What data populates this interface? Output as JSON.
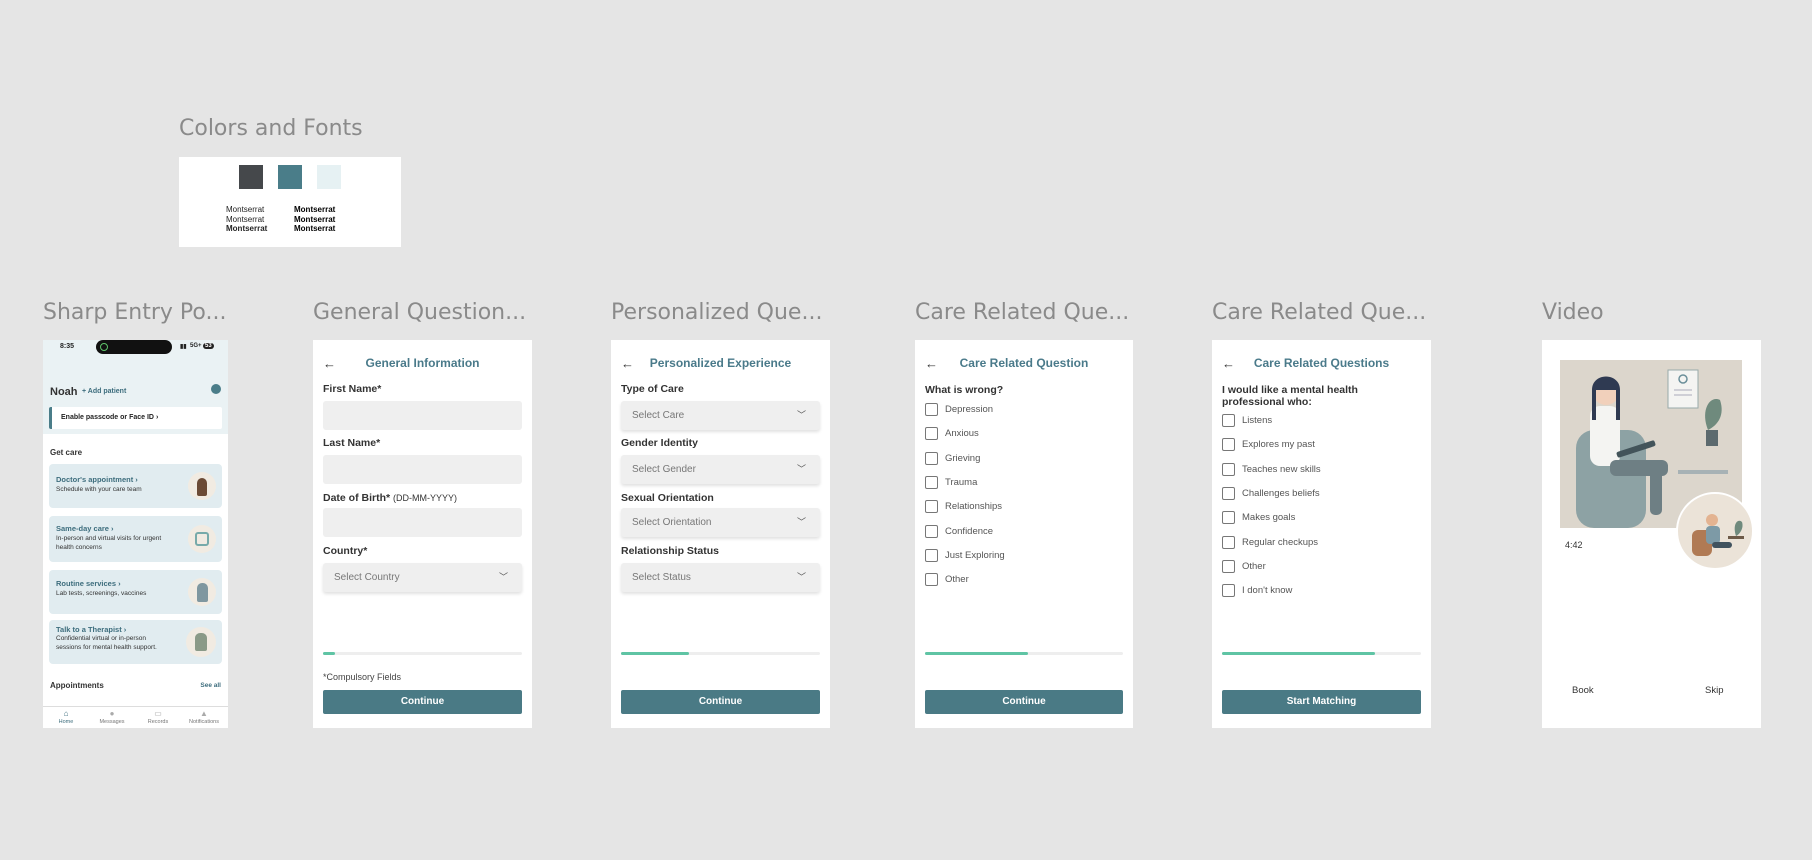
{
  "colors_section": {
    "title": "Colors and Fonts",
    "swatches": [
      "#45484b",
      "#4a7d89",
      "#e6f1f3"
    ],
    "font_samples_regular": [
      "Montserrat",
      "Montserrat",
      "Montserrat"
    ],
    "font_samples_bold": [
      "Montserrat",
      "Montserrat",
      "Montserrat"
    ]
  },
  "frames": {
    "sharp_title": "Sharp Entry Po...",
    "general_title": "General Question...",
    "personalized_title": "Personalized Que...",
    "care1_title": "Care Related Que...",
    "care2_title": "Care Related Que...",
    "video_title": "Video"
  },
  "sharp": {
    "time": "8:35",
    "status_right": "5G+",
    "battery": "53",
    "user_name": "Noah",
    "add_patient": "+ Add patient",
    "banner": "Enable passcode or Face ID",
    "get_care": "Get care",
    "cards": [
      {
        "title": "Doctor's appointment",
        "sub": "Schedule with your care team"
      },
      {
        "title": "Same-day care",
        "sub": "In-person and virtual visits for urgent health concerns"
      },
      {
        "title": "Routine services",
        "sub": "Lab tests, screenings, vaccines"
      },
      {
        "title": "Talk to a Therapist",
        "sub": "Confidential virtual or in-person sessions for mental health support."
      }
    ],
    "appointments": "Appointments",
    "see_all": "See all",
    "tabs": [
      "Home",
      "Messages",
      "Records",
      "Notifications"
    ]
  },
  "general": {
    "header": "General Information",
    "first_name": "First Name*",
    "last_name": "Last Name*",
    "dob": "Date of Birth*",
    "dob_format": "(DD-MM-YYYY)",
    "country": "Country*",
    "country_placeholder": "Select Country",
    "progress": 0.06,
    "compulsory": "*Compulsory Fields",
    "continue": "Continue"
  },
  "personalized": {
    "header": "Personalized Experience",
    "type_of_care": "Type of Care",
    "care_placeholder": "Select Care",
    "gender_identity": "Gender Identity",
    "gender_placeholder": "Select Gender",
    "sexual_orientation": "Sexual Orientation",
    "orientation_placeholder": "Select Orientation",
    "relationship_status": "Relationship Status",
    "status_placeholder": "Select Status",
    "progress": 0.34,
    "continue": "Continue"
  },
  "care1": {
    "header": "Care Related Question",
    "question": "What is wrong?",
    "options": [
      "Depression",
      "Anxious",
      "Grieving",
      "Trauma",
      "Relationships",
      "Confidence",
      "Just Exploring",
      "Other"
    ],
    "progress": 0.52,
    "continue": "Continue"
  },
  "care2": {
    "header": "Care Related Questions",
    "question": "I would like a mental health professional who:",
    "options": [
      "Listens",
      "Explores my past",
      "Teaches new skills",
      "Challenges beliefs",
      "Makes goals",
      "Regular checkups",
      "Other",
      "I don't know"
    ],
    "progress": 0.77,
    "button": "Start Matching"
  },
  "video": {
    "duration": "4:42",
    "book": "Book",
    "skip": "Skip"
  }
}
